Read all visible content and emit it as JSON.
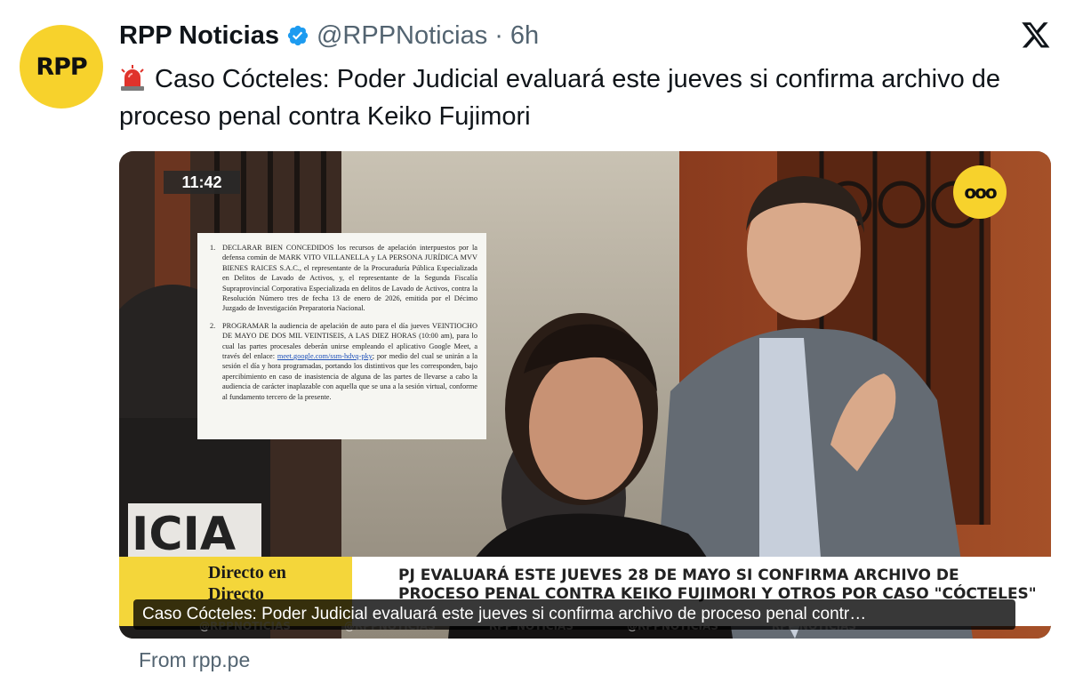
{
  "author": {
    "avatar_text": "RPP",
    "display_name": "RPP Noticias",
    "handle": "@RPPNoticias",
    "separator": "·",
    "time": "6h"
  },
  "icons": {
    "verified": "verified-badge-icon",
    "platform": "x-logo-icon",
    "siren": "police-siren-emoji"
  },
  "tweet": {
    "text": "Caso Cócteles: Poder Judicial evaluará este jueves si confirma archivo de proceso penal contra Keiko Fujimori"
  },
  "media": {
    "timestamp": "11:42",
    "badge_text": "ooo",
    "sign_text": "ICIA",
    "document": {
      "item1_num": "1.",
      "item1_text": "DECLARAR BIEN CONCEDIDOS los recursos de apelación interpuestos por la defensa común de MARK VITO VILLANELLA y LA PERSONA JURÍDICA MVV BIENES RAICES S.A.C., el representante de la Procuraduría Pública Especializada en Delitos de Lavado de Activos, y, el representante de la Segunda Fiscalía Supraprovincial Corporativa Especializada en delitos de Lavado de Activos, contra la Resolución Número tres de fecha 13 de enero de 2026, emitida por el Décimo Juzgado de Investigación Preparatoria Nacional.",
      "item2_num": "2.",
      "item2_text_a": "PROGRAMAR la audiencia de apelación de auto para el día jueves VEINTIOCHO DE MAYO DE DOS MIL VEINTISEIS, A LAS DIEZ HORAS (10:00 am), para lo cual las partes procesales deberán unirse empleando el aplicativo Google Meet, a través del enlace:",
      "item2_link": "meet.google.com/ssm-hdvq-pky",
      "item2_text_b": "; por medio del cual se unirán a la sesión el día y hora programadas, portando los distintivos que les corresponden, bajo apercibimiento en caso de inasistencia de alguna de las partes de llevarse a cabo la audiencia de carácter inaplazable con aquella que se una a la sesión virtual, conforme al fundamento tercero de la presente."
    },
    "lower_third": {
      "label": "Directo en Directo",
      "headline": "PJ EVALUARÁ ESTE JUEVES 28 DE MAYO SI CONFIRMA ARCHIVO DE PROCESO PENAL CONTRA KEIKO FUJIMORI Y OTROS POR CASO \"CÓCTELES\""
    },
    "watermarks": [
      "@RPPNOTICIAS",
      "@RPPNOTICIAS",
      "RPP NOTICIAS",
      "@RPPNOTICIAS",
      "RPP NOTICIAS"
    ],
    "caption": "Caso Cócteles: Poder Judicial evaluará este jueves si confirma archivo de proceso penal contr…"
  },
  "source": "From rpp.pe",
  "colors": {
    "brand_yellow": "#f7d22c",
    "verified_blue": "#1d9bf0",
    "muted_text": "#536471"
  }
}
